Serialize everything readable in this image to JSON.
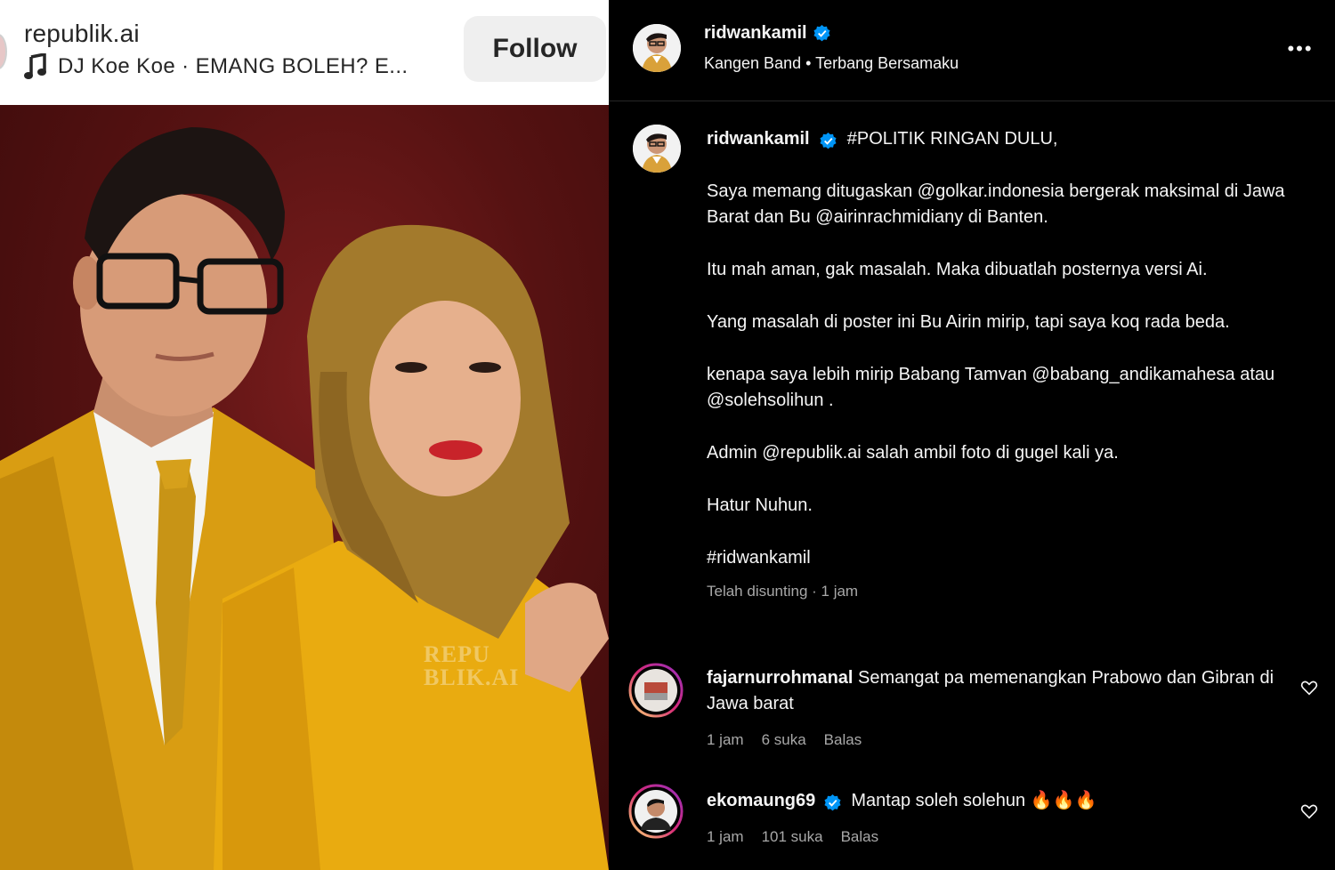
{
  "left": {
    "username": "republik.ai",
    "music": "DJ Koe Koe · EMANG BOLEH? E...",
    "follow_label": "Follow",
    "watermark_line1": "REPU",
    "watermark_line2": "BLIK.AI"
  },
  "post": {
    "username": "ridwankamil",
    "music": "Kangen Band • Terbang Bersamaku",
    "more_label": "•••"
  },
  "caption": {
    "username": "ridwankamil",
    "first_line": "#POLITIK RINGAN DULU,",
    "paragraphs": [
      "Saya memang ditugaskan @golkar.indonesia bergerak maksimal di Jawa Barat dan Bu @airinrachmidiany di Banten.",
      "Itu mah aman, gak masalah. Maka dibuatlah posternya versi Ai.",
      "Yang masalah di poster ini Bu Airin mirip, tapi saya koq rada beda.",
      "kenapa saya lebih mirip Babang Tamvan @babang_andikamahesa atau @solehsolihun .",
      "Admin @republik.ai salah ambil foto di gugel kali ya.",
      "Hatur Nuhun.",
      "#ridwankamil"
    ],
    "meta": "Telah disunting · 1 jam"
  },
  "comments": [
    {
      "username": "fajarnurrohmanal",
      "text": "Semangat pa memenangkan Prabowo dan Gibran di Jawa barat",
      "time": "1 jam",
      "likes": "6 suka",
      "reply": "Balas"
    },
    {
      "username": "ekomaung69",
      "text": "Mantap soleh solehun 🔥🔥🔥",
      "time": "1 jam",
      "likes": "101 suka",
      "reply": "Balas"
    }
  ],
  "colors": {
    "verified": "#0095f6",
    "muted": "#a8a8a8",
    "suit_yellow": "#e1a814",
    "hijab": "#a37a2c",
    "backdrop": "#5a1414"
  }
}
